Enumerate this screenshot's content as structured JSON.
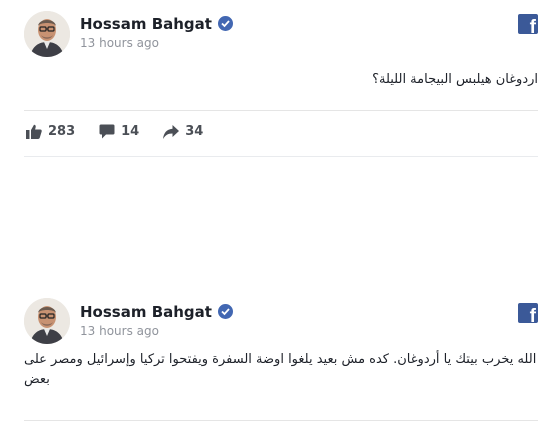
{
  "posts": [
    {
      "author": "Hossam Bahgat",
      "time": "13 hours ago",
      "text": "اردوغان هيلبس البيجامة الليلة؟",
      "likes": "283",
      "comments": "14",
      "shares": "34"
    },
    {
      "author": "Hossam Bahgat",
      "time": "13 hours ago",
      "text": "الله يخرب بيتك يا أردوغان. كده مش بعيد يلغوا اوضة السفرة ويفتحوا تركيا وإسرائيل ومصر على بعض"
    }
  ],
  "colors": {
    "facebook_blue": "#3b5998",
    "verified_blue": "#4267b2",
    "meta_gray": "#90949c",
    "action_gray": "#4b4f56"
  },
  "icons": [
    "facebook-icon",
    "verified-badge-icon",
    "like-icon",
    "comment-icon",
    "share-icon"
  ]
}
